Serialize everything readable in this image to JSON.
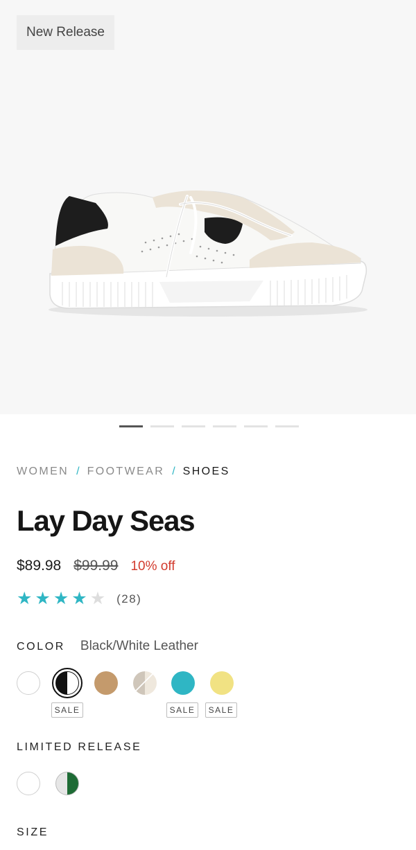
{
  "hero": {
    "badge": "New Release",
    "product_image": "sneaker-white-black-leather",
    "carousel_total": 6,
    "carousel_active_index": 0
  },
  "breadcrumb": {
    "items": [
      "WOMEN",
      "FOOTWEAR",
      "SHOES"
    ],
    "separator": "/"
  },
  "product": {
    "title": "Lay Day Seas",
    "price": "$89.98",
    "original_price": "$99.99",
    "discount": "10% off",
    "rating": 4,
    "rating_max": 5,
    "review_count": "(28)"
  },
  "color": {
    "label": "COLOR",
    "selected": "Black/White Leather",
    "swatches": [
      {
        "name": "white",
        "color": "#ffffff",
        "sale": ""
      },
      {
        "name": "black-white",
        "color": "#111111",
        "sale": "SALE",
        "selected": true
      },
      {
        "name": "tan",
        "color": "#c49a6c",
        "sale": ""
      },
      {
        "name": "grey-cream",
        "color": "#d8d0c6",
        "sale": ""
      },
      {
        "name": "teal",
        "color": "#2fb6c4",
        "sale": "SALE"
      },
      {
        "name": "yellow",
        "color": "#f1e283",
        "sale": "SALE"
      }
    ]
  },
  "limited_release": {
    "label": "LIMITED RELEASE",
    "swatches": [
      {
        "name": "white",
        "color": "#ffffff"
      },
      {
        "name": "white-green",
        "color": "#1e6b35"
      }
    ]
  },
  "size": {
    "label": "SIZE"
  },
  "colors": {
    "accent": "#2fb6c4",
    "discount": "#d23b2e",
    "hero_bg": "#f7f7f7"
  }
}
